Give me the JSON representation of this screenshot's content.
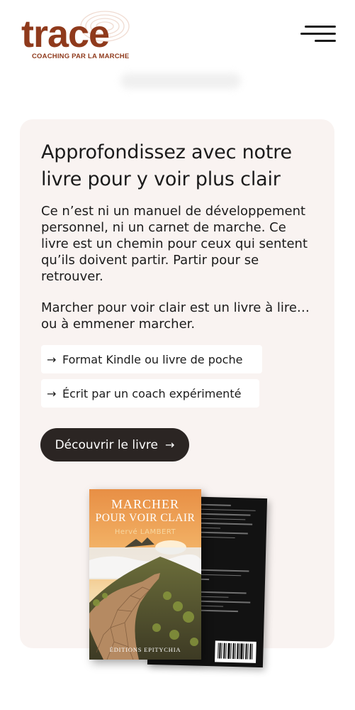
{
  "header": {
    "logo_word": "trace",
    "logo_tagline": "COACHING PAR LA MARCHE",
    "menu_icon": "hamburger-menu-icon"
  },
  "section": {
    "title": "Approfondissez avec notre livre pour y voir plus clair",
    "paragraph1": "Ce n’est ni un manuel de développement personnel, ni un carnet de marche. Ce livre est un chemin pour ceux qui sentent qu’ils doivent partir. Partir pour se retrouver.",
    "paragraph2": "Marcher pour voir clair est un livre à lire… ou à emmener marcher.",
    "features": [
      {
        "arrow": "→",
        "label": "Format Kindle ou livre de poche"
      },
      {
        "arrow": "→",
        "label": "Écrit par un coach expérimenté"
      }
    ],
    "cta": {
      "label": "Découvrir le livre",
      "arrow": "→"
    }
  },
  "book": {
    "title_line1": "MARCHER",
    "title_line2": "POUR VOIR CLAIR",
    "author": "Hervé LAMBERT",
    "publisher": "ÉDITIONS EPITYCHIA"
  },
  "colors": {
    "brand": "#8f3a1c",
    "card_background": "#f9f3f1",
    "cta_background": "#2b2523",
    "text": "#1b1b1b"
  }
}
